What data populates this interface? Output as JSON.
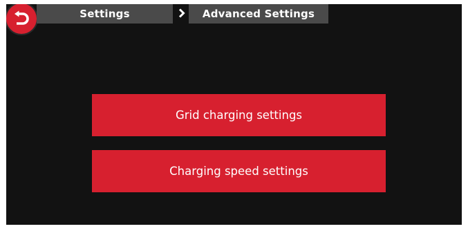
{
  "breadcrumb": {
    "parent_label": "Settings",
    "current_label": "Advanced Settings"
  },
  "menu": {
    "items": [
      {
        "label": "Grid charging settings"
      },
      {
        "label": "Charging speed settings"
      }
    ]
  },
  "icons": {
    "back": "back-arrow-icon",
    "separator": "chevron-right-icon"
  },
  "colors": {
    "accent": "#d7202f",
    "background": "#121212",
    "breadcrumb_bg": "#4a4a4a"
  }
}
